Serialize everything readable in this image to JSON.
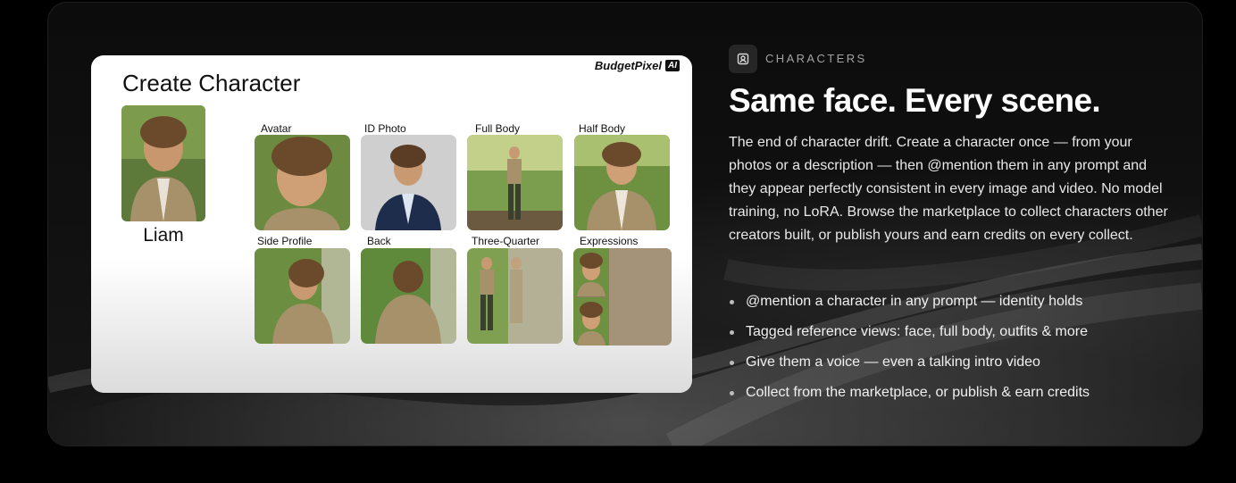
{
  "card": {
    "title": "Create Character",
    "brand": "BudgetPixel",
    "brand_badge": "AI",
    "character_name": "Liam",
    "views": [
      {
        "label": "Avatar"
      },
      {
        "label": "ID Photo"
      },
      {
        "label": "Full Body"
      },
      {
        "label": "Half Body"
      },
      {
        "label": "Side Profile"
      },
      {
        "label": "Back"
      },
      {
        "label": "Three-Quarter"
      },
      {
        "label": "Expressions"
      }
    ]
  },
  "section": {
    "icon": "character-id-icon",
    "eyebrow": "CHARACTERS",
    "headline": "Same face. Every scene.",
    "description": "The end of character drift. Create a character once — from your photos or a description — then @mention them in any prompt and they appear perfectly consistent in every image and video. No model training, no LoRA. Browse the marketplace to collect characters other creators built, or publish yours and earn credits on every collect.",
    "bullets": [
      "@mention a character in any prompt — identity holds",
      "Tagged reference views: face, full body, outfits & more",
      "Give them a voice — even a talking intro video",
      "Collect from the marketplace, or publish & earn credits"
    ]
  },
  "colors": {
    "background": "#000000",
    "panel": "#101010",
    "accent_text": "#ffffff",
    "muted_text": "#a3a3a3"
  }
}
